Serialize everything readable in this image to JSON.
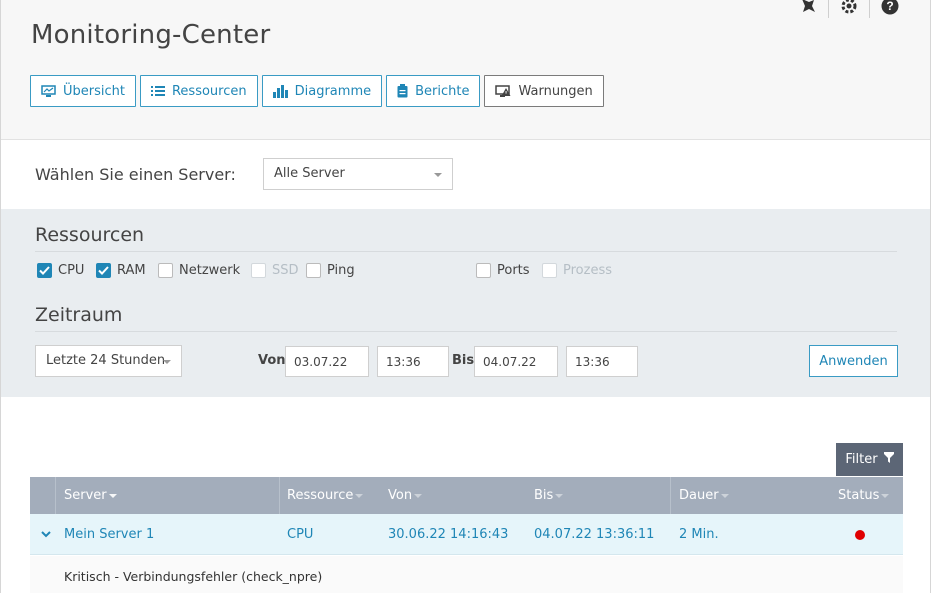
{
  "header": {
    "title": "Monitoring-Center",
    "top_icons": [
      "pin-icon",
      "gear-icon",
      "help-icon"
    ],
    "tabs": [
      {
        "label": "Übersicht",
        "icon": "monitor-icon"
      },
      {
        "label": "Ressourcen",
        "icon": "list-icon"
      },
      {
        "label": "Diagramme",
        "icon": "bar-chart-icon"
      },
      {
        "label": "Berichte",
        "icon": "clipboard-icon"
      },
      {
        "label": "Warnungen",
        "icon": "warning-monitor-icon"
      }
    ]
  },
  "server_select": {
    "label": "Wählen Sie einen Server:",
    "value": "Alle Server"
  },
  "resources": {
    "title": "Ressourcen",
    "items": [
      {
        "label": "CPU",
        "checked": true,
        "disabled": false
      },
      {
        "label": "RAM",
        "checked": true,
        "disabled": false
      },
      {
        "label": "Netzwerk",
        "checked": false,
        "disabled": false
      },
      {
        "label": "SSD",
        "checked": false,
        "disabled": true
      },
      {
        "label": "Ping",
        "checked": false,
        "disabled": false
      },
      {
        "label": "Ports",
        "checked": false,
        "disabled": false
      },
      {
        "label": "Prozess",
        "checked": false,
        "disabled": true
      }
    ]
  },
  "timeframe": {
    "title": "Zeitraum",
    "range": "Letzte 24 Stunden",
    "from_label": "Von",
    "from_date": "03.07.22",
    "from_time": "13:36",
    "to_label": "Bis",
    "to_date": "04.07.22",
    "to_time": "13:36",
    "apply_label": "Anwenden"
  },
  "results": {
    "filter_label": "Filter",
    "columns": [
      "Server",
      "Ressource",
      "Von",
      "Bis",
      "Dauer",
      "Status"
    ],
    "rows": [
      {
        "server": "Mein Server 1",
        "resource": "CPU",
        "from": "30.06.22 14:16:43",
        "to": "04.07.22 13:36:11",
        "duration": "2 Min.",
        "status_color": "#e00000",
        "detail": "Kritisch - Verbindungsfehler (check_npre)"
      }
    ]
  }
}
